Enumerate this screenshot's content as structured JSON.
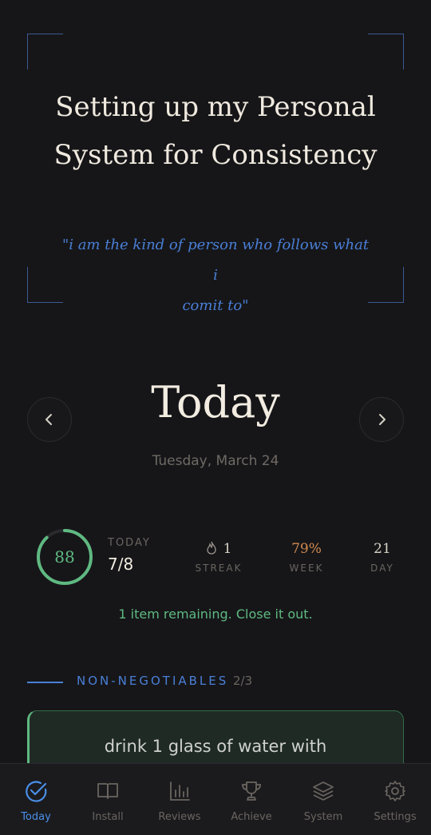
{
  "hero": {
    "title_line1": "Setting up my Personal",
    "title_line2": "System for Consistency",
    "quote_line1": "\"i am the kind of person who follows what i",
    "quote_line2": "comit to\""
  },
  "day": {
    "title": "Today",
    "date": "Tuesday, March 24",
    "prev_icon": "chevron-left-icon",
    "next_icon": "chevron-right-icon"
  },
  "stats": {
    "score": "88",
    "score_fraction": 0.88,
    "today_label": "TODAY",
    "today_value": "7/8",
    "streak_value": "1",
    "streak_label": "STREAK",
    "week_value": "79%",
    "week_label": "WEEK",
    "day_value": "21",
    "day_label": "DAY",
    "remaining": "1 item remaining. Close it out."
  },
  "section": {
    "title": "NON-NEGOTIABLES",
    "count": "2/3"
  },
  "card": {
    "text": "drink 1 glass of water with"
  },
  "tabs": [
    {
      "label": "Today",
      "icon": "check-circle-icon",
      "active": true
    },
    {
      "label": "Install",
      "icon": "book-icon",
      "active": false
    },
    {
      "label": "Reviews",
      "icon": "bar-chart-icon",
      "active": false
    },
    {
      "label": "Achieve",
      "icon": "trophy-icon",
      "active": false
    },
    {
      "label": "System",
      "icon": "layers-icon",
      "active": false
    },
    {
      "label": "Settings",
      "icon": "gear-icon",
      "active": false
    }
  ],
  "colors": {
    "background": "#161619",
    "accent_blue": "#4a8fe8",
    "accent_green": "#5fb981",
    "accent_orange": "#d08a4e"
  }
}
